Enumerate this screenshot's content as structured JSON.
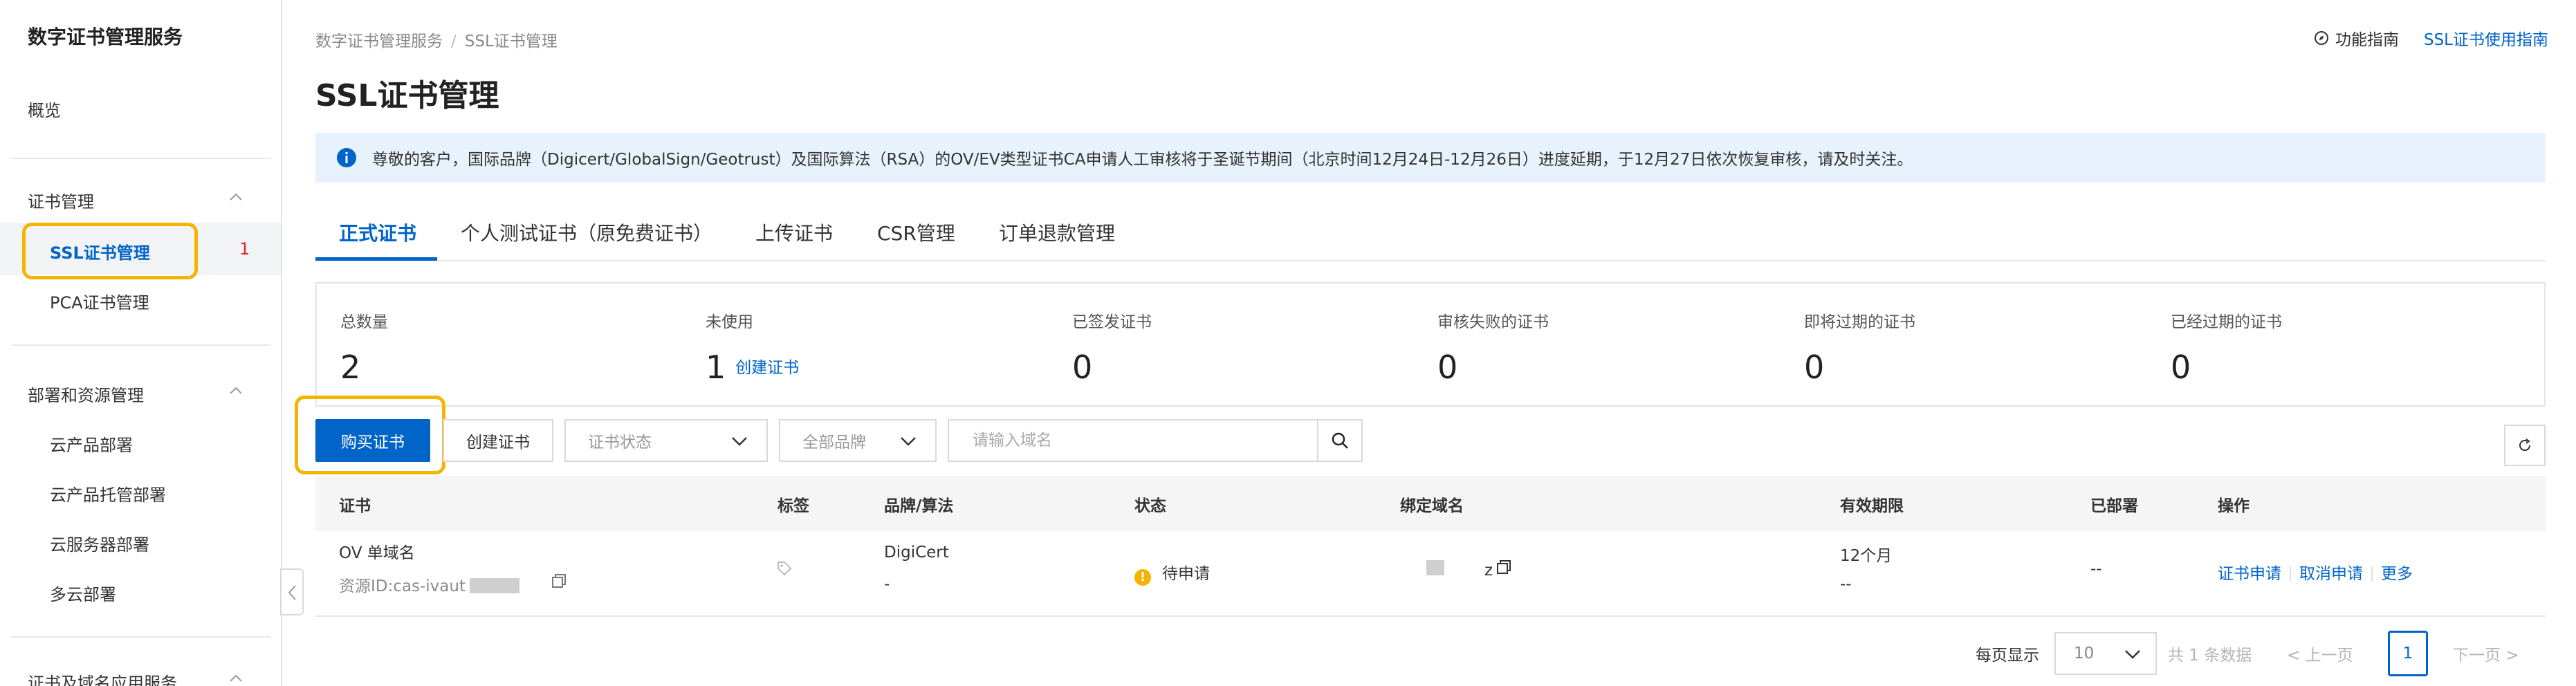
{
  "sidebar": {
    "title": "数字证书管理服务",
    "overview": "概览",
    "groups": [
      {
        "label": "证书管理",
        "items": [
          {
            "label": "SSL证书管理",
            "badge": "1",
            "active": true
          },
          {
            "label": "PCA证书管理"
          }
        ]
      },
      {
        "label": "部署和资源管理",
        "items": [
          {
            "label": "云产品部署"
          },
          {
            "label": "云产品托管部署"
          },
          {
            "label": "云服务器部署"
          },
          {
            "label": "多云部署"
          }
        ]
      },
      {
        "label": "证书及域名应用服务"
      }
    ]
  },
  "header": {
    "breadcrumb": [
      "数字证书管理服务",
      "SSL证书管理"
    ],
    "guide_link": "功能指南",
    "ssl_guide_link": "SSL证书使用指南",
    "title": "SSL证书管理"
  },
  "notice": {
    "text": "尊敬的客户，国际品牌（Digicert/GlobalSign/Geotrust）及国际算法（RSA）的OV/EV类型证书CA申请人工审核将于圣诞节期间（北京时间12月24日-12月26日）进度延期，于12月27日依次恢复审核，请及时关注。"
  },
  "tabs": [
    "正式证书",
    "个人测试证书（原免费证书）",
    "上传证书",
    "CSR管理",
    "订单退款管理"
  ],
  "stats": [
    {
      "label": "总数量",
      "value": "2"
    },
    {
      "label": "未使用",
      "value": "1",
      "link": "创建证书"
    },
    {
      "label": "已签发证书",
      "value": "0"
    },
    {
      "label": "审核失败的证书",
      "value": "0"
    },
    {
      "label": "即将过期的证书",
      "value": "0"
    },
    {
      "label": "已经过期的证书",
      "value": "0"
    }
  ],
  "toolbar": {
    "buy_label": "购买证书",
    "create_label": "创建证书",
    "status_select": "证书状态",
    "brand_select": "全部品牌",
    "search_placeholder": "请输入域名"
  },
  "table": {
    "columns": [
      "证书",
      "标签",
      "品牌/算法",
      "状态",
      "绑定域名",
      "有效期限",
      "已部署",
      "操作"
    ],
    "rows": [
      {
        "name": "OV 单域名",
        "resource_id": "资源ID:cas-ivaut",
        "brand": "DigiCert",
        "algo": "-",
        "status": "待申请",
        "domain": "z",
        "validity": "12个月",
        "validity_sub": "--",
        "deployed": "--",
        "actions": [
          "证书申请",
          "取消申请",
          "更多"
        ]
      }
    ]
  },
  "pagination": {
    "per_page_label": "每页显示",
    "per_page_value": "10",
    "total": "共 1 条数据",
    "prev": "上一页",
    "current": "1",
    "next": "下一页"
  },
  "colors": {
    "primary": "#0064c8",
    "highlight": "#f5b400",
    "badge": "#e0242a",
    "notice_bg": "#e8f2fd"
  }
}
